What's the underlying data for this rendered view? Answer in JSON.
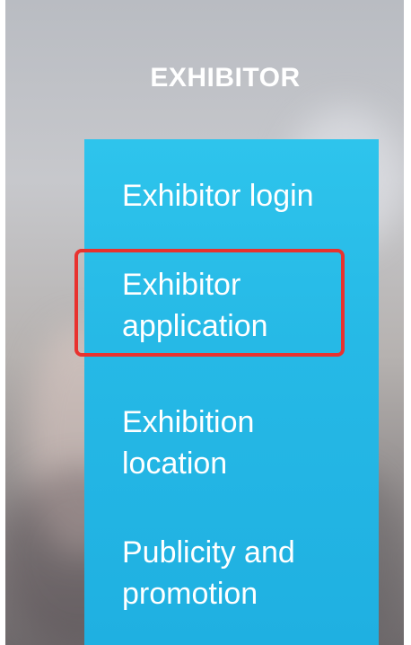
{
  "section": {
    "title": "EXHIBITOR"
  },
  "menu": {
    "items": [
      {
        "label": "Exhibitor login"
      },
      {
        "label": "Exhibitor application"
      },
      {
        "label": "Exhibition location"
      },
      {
        "label": "Publicity and promotion"
      }
    ],
    "highlighted_index": 1
  },
  "colors": {
    "menu_background": "#26b9e6",
    "highlight_border": "#e8322f",
    "text": "#ffffff"
  }
}
